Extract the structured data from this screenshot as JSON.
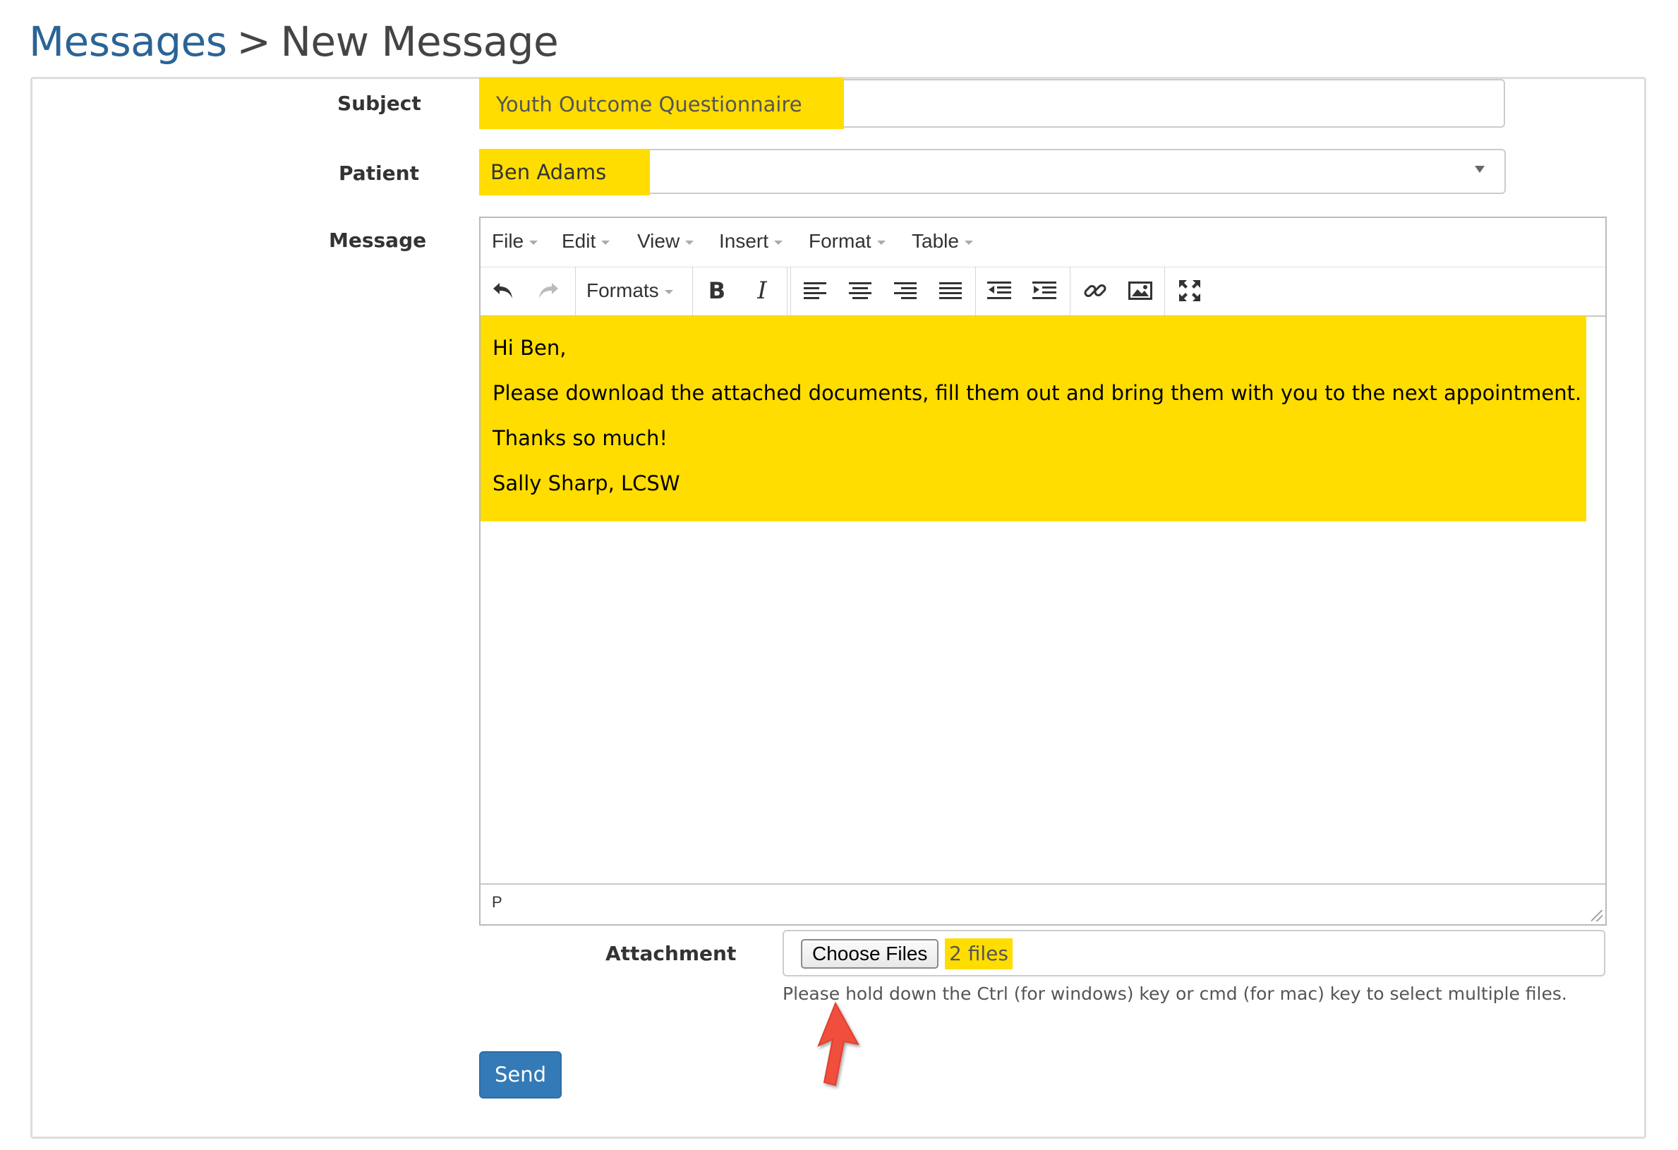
{
  "header": {
    "breadcrumb_link": "Messages",
    "separator": ">",
    "title": "New Message"
  },
  "form": {
    "subject_label": "Subject",
    "subject_value": "Youth Outcome Questionnaire",
    "patient_label": "Patient",
    "patient_value": "Ben Adams",
    "message_label": "Message",
    "attachment_label": "Attachment",
    "choose_files_label": "Choose Files",
    "files_selected": "2 files",
    "help_text": "Please hold down the Ctrl (for windows) key or cmd (for mac) key to select multiple files.",
    "send_label": "Send"
  },
  "editor": {
    "menus": [
      "File",
      "Edit",
      "View",
      "Insert",
      "Format",
      "Table"
    ],
    "formats_label": "Formats",
    "content": [
      "Hi Ben,",
      "Please download the attached documents, fill them out and bring them with you to the next appointment.",
      "Thanks so much!",
      "Sally Sharp, LCSW"
    ],
    "status_path": "P",
    "toolbar_icons": [
      "undo-icon",
      "redo-icon",
      "bold-icon",
      "italic-icon",
      "align-left-icon",
      "align-center-icon",
      "align-right-icon",
      "align-justify-icon",
      "outdent-icon",
      "indent-icon",
      "link-icon",
      "image-icon",
      "fullscreen-icon"
    ]
  },
  "colors": {
    "highlight": "#ffdd00",
    "link": "#2a6496",
    "primary_button": "#337ab7",
    "annotation_arrow": "#f0503e"
  }
}
